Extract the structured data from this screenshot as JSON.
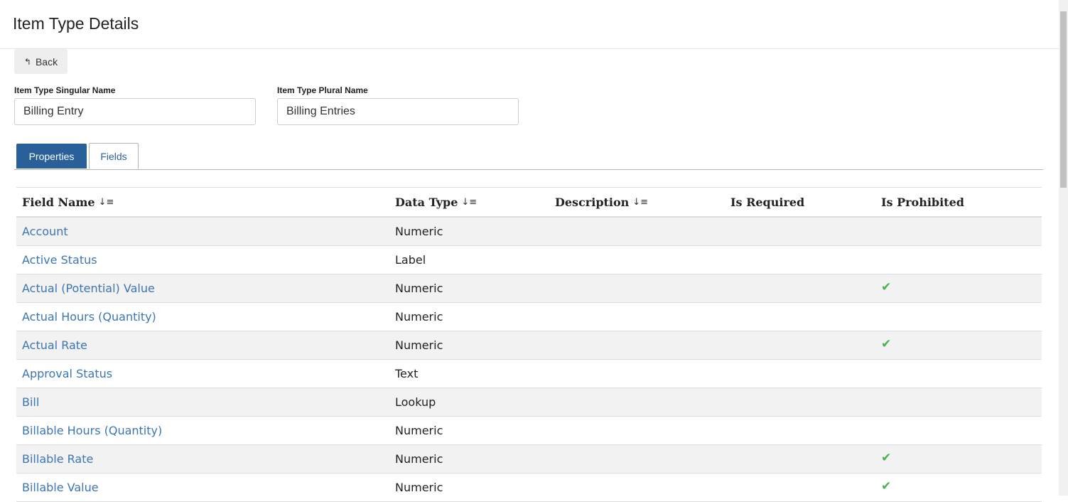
{
  "page": {
    "title": "Item Type Details"
  },
  "toolbar": {
    "back_label": "Back"
  },
  "form": {
    "singular_label": "Item Type Singular Name",
    "singular_value": "Billing Entry",
    "plural_label": "Item Type Plural Name",
    "plural_value": "Billing Entries"
  },
  "tabs": [
    {
      "label": "Properties",
      "active": true
    },
    {
      "label": "Fields",
      "active": false
    }
  ],
  "table": {
    "columns": [
      "Field Name",
      "Data Type",
      "Description",
      "Is Required",
      "Is Prohibited"
    ],
    "sort_icon": "↓≡",
    "check_glyph": "✔",
    "rows": [
      {
        "name": "Account",
        "type": "Numeric",
        "description": "",
        "required": false,
        "prohibited": false
      },
      {
        "name": "Active Status",
        "type": "Label",
        "description": "",
        "required": false,
        "prohibited": false
      },
      {
        "name": "Actual (Potential) Value",
        "type": "Numeric",
        "description": "",
        "required": false,
        "prohibited": true
      },
      {
        "name": "Actual Hours (Quantity)",
        "type": "Numeric",
        "description": "",
        "required": false,
        "prohibited": false
      },
      {
        "name": "Actual Rate",
        "type": "Numeric",
        "description": "",
        "required": false,
        "prohibited": true
      },
      {
        "name": "Approval Status",
        "type": "Text",
        "description": "",
        "required": false,
        "prohibited": false
      },
      {
        "name": "Bill",
        "type": "Lookup",
        "description": "",
        "required": false,
        "prohibited": false
      },
      {
        "name": "Billable Hours (Quantity)",
        "type": "Numeric",
        "description": "",
        "required": false,
        "prohibited": false
      },
      {
        "name": "Billable Rate",
        "type": "Numeric",
        "description": "",
        "required": false,
        "prohibited": true
      },
      {
        "name": "Billable Value",
        "type": "Numeric",
        "description": "",
        "required": false,
        "prohibited": true
      }
    ]
  },
  "colors": {
    "accent": "#2a6099",
    "link": "#3a76b3",
    "check": "#4caf50",
    "row_stripe": "#f2f2f2"
  }
}
